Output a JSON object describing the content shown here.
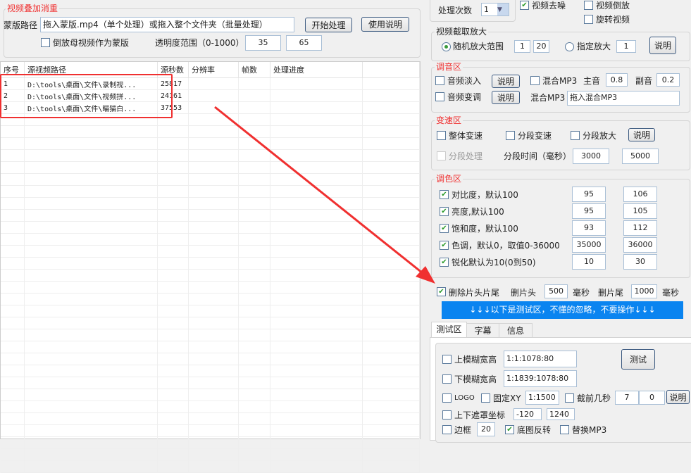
{
  "overlay": {
    "title": "视频叠加消重",
    "mask_label": "蒙版路径",
    "mask_value": "拖入蒙版.mp4（单个处理）或拖入整个文件夹（批量处理）",
    "start_button": "开始处理",
    "help_button": "使用说明",
    "reverse_label": "倒放母视频作为蒙版",
    "reverse_checked": false,
    "opacity_label": "透明度范围（0-1000）",
    "opacity_min": "35",
    "opacity_max": "65"
  },
  "table": {
    "headers": [
      "序号",
      "源视频路径",
      "源秒数",
      "分辨率",
      "帧数",
      "处理进度"
    ],
    "rows": [
      [
        "1",
        "D:\\tools\\桌面\\文件\\录制视...",
        "25817",
        "",
        "",
        ""
      ],
      [
        "2",
        "D:\\tools\\桌面\\文件\\视频拼...",
        "24161",
        "",
        "",
        ""
      ],
      [
        "3",
        "D:\\tools\\桌面\\文件\\瞄猫白...",
        "37553",
        "",
        "",
        ""
      ]
    ]
  },
  "top": {
    "times_label": "处理次数",
    "times_value": "1",
    "denoise": "视频去噪",
    "reverse": "视频倒放",
    "rotate": "旋转视频"
  },
  "crop": {
    "title": "视频截取放大",
    "random_label": "随机放大范围",
    "random_min": "1",
    "random_max": "20",
    "fixed_label": "指定放大",
    "fixed_value": "1",
    "help": "说明"
  },
  "audio": {
    "title": "调音区",
    "fadein": "音频淡入",
    "pitch": "音频变调",
    "help": "说明",
    "mix_label": "混合MP3",
    "main_label": "主音",
    "main_value": "0.8",
    "sub_label": "副音",
    "sub_value": "0.2",
    "mix_path_label": "混合MP3",
    "mix_path_value": "拖入混合MP3"
  },
  "speed": {
    "title": "变速区",
    "whole": "整体变速",
    "segment": "分段变速",
    "seg_zoom": "分段放大",
    "help": "说明",
    "seg_process": "分段处理",
    "seg_time_label": "分段时间（毫秒）",
    "seg_min": "3000",
    "seg_max": "5000"
  },
  "color": {
    "title": "调色区",
    "rows": [
      {
        "label": "对比度，默认100",
        "min": "95",
        "max": "106"
      },
      {
        "label": "亮度,默认100",
        "min": "95",
        "max": "105"
      },
      {
        "label": "饱和度，默认100",
        "min": "93",
        "max": "112"
      },
      {
        "label": "色调，默认0，取值0-36000",
        "min": "35000",
        "max": "36000"
      },
      {
        "label": "锐化默认为10(0到50)",
        "min": "10",
        "max": "30"
      }
    ]
  },
  "trim": {
    "label": "删除片头片尾",
    "head_label": "删片头",
    "head_value": "500",
    "unit": "毫秒",
    "tail_label": "删片尾",
    "tail_value": "1000",
    "unit2": "毫秒"
  },
  "banner": "↓↓↓以下是测试区，不懂的忽略，不要操作↓↓↓",
  "tabs": [
    "测试区",
    "字幕",
    "信息"
  ],
  "test": {
    "top_blur": "上模糊宽高",
    "top_blur_value": "1:1:1078:80",
    "bottom_blur": "下模糊宽高",
    "bottom_blur_value": "1:1839:1078:80",
    "test_button": "测试",
    "logo": "LOGO",
    "fixed_xy": "固定XY",
    "fixed_xy_value": "1:1500",
    "cut_front": "截前几秒",
    "cut_a": "7",
    "cut_b": "0",
    "help": "说明",
    "mask_coord": "上下遮罩坐标",
    "mask_a": "-120",
    "mask_b": "1240",
    "border": "边框",
    "border_value": "20",
    "flip": "底图反转",
    "replace_mp3": "替换MP3"
  },
  "colors": {
    "accent": "#0a84f0",
    "annotation": "#f03030"
  }
}
